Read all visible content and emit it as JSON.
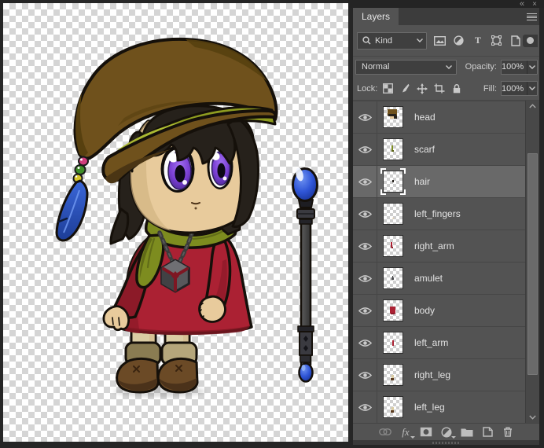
{
  "window": {
    "collapse": "«",
    "close": "×"
  },
  "panel": {
    "tab_label": "Layers",
    "kind_label": "Kind",
    "blend_mode": "Normal",
    "opacity_label": "Opacity:",
    "opacity_value": "100%",
    "lock_label": "Lock:",
    "fill_label": "Fill:",
    "fill_value": "100%",
    "filter_icons": [
      "pixel-layer-filter",
      "adjustment-layer-filter",
      "type-layer-filter",
      "shape-layer-filter",
      "smart-object-filter"
    ],
    "layers": [
      {
        "name": "head",
        "visible": true,
        "selected": false,
        "thumb": "head"
      },
      {
        "name": "scarf",
        "visible": true,
        "selected": false,
        "thumb": "scarf"
      },
      {
        "name": "hair",
        "visible": true,
        "selected": true,
        "thumb": "hair"
      },
      {
        "name": "left_fingers",
        "visible": true,
        "selected": false,
        "thumb": "blank"
      },
      {
        "name": "right_arm",
        "visible": true,
        "selected": false,
        "thumb": "arm"
      },
      {
        "name": "amulet",
        "visible": true,
        "selected": false,
        "thumb": "amulet"
      },
      {
        "name": "body",
        "visible": true,
        "selected": false,
        "thumb": "body"
      },
      {
        "name": "left_arm",
        "visible": true,
        "selected": false,
        "thumb": "arm2"
      },
      {
        "name": "right_leg",
        "visible": true,
        "selected": false,
        "thumb": "leg"
      },
      {
        "name": "left_leg",
        "visible": true,
        "selected": false,
        "thumb": "leg"
      }
    ],
    "thumb_marks": {
      "head": [
        [
          20,
          12,
          50,
          30,
          "#6f511c"
        ],
        [
          32,
          40,
          26,
          18,
          "#e8cb9c"
        ],
        [
          26,
          36,
          40,
          10,
          "#26211b"
        ],
        [
          56,
          42,
          14,
          14,
          "#26211b"
        ]
      ],
      "scarf": [
        [
          40,
          32,
          11,
          22,
          "#7d8c1f"
        ],
        [
          42,
          52,
          12,
          8,
          "#5a6416"
        ]
      ],
      "hair": [
        [
          44,
          42,
          11,
          11,
          "#221d17"
        ]
      ],
      "blank": [
        [
          47,
          68,
          7,
          6,
          "#e8cb9c"
        ]
      ],
      "arm": [
        [
          37,
          30,
          9,
          26,
          "#ab2133"
        ],
        [
          41,
          52,
          10,
          9,
          "#8c1a28"
        ]
      ],
      "amulet": [
        [
          44,
          40,
          7,
          9,
          "#3b3b3b"
        ],
        [
          42,
          48,
          11,
          8,
          "#4f4f52"
        ]
      ],
      "body": [
        [
          33,
          30,
          30,
          36,
          "#ab2133"
        ],
        [
          37,
          60,
          22,
          9,
          "#8c1a28"
        ]
      ],
      "arm2": [
        [
          46,
          40,
          8,
          24,
          "#ab2133"
        ]
      ],
      "leg": [
        [
          42,
          50,
          12,
          16,
          "#dbcda4"
        ],
        [
          37,
          66,
          19,
          12,
          "#5a3a1e"
        ]
      ]
    }
  },
  "icons": {
    "type_filter": "T",
    "fx": "fx"
  },
  "colors": {
    "checker_gray": "#d5d5d5",
    "panel_bg": "#535353",
    "panel_dark": "#3c3c3c",
    "field_bg": "#3f3f3f",
    "field_border": "#6a6a6a",
    "row_selected": "#696969",
    "sb_track": "#484848",
    "sb_thumb": "#6a6a6a",
    "outline": "#15100a",
    "hat_main": "#6f511c",
    "hat_dark": "#57400f",
    "hat_band": "#8e9c20",
    "band_hi": "#b2c135",
    "brim_under": "#4a3514",
    "hair": "#26211b",
    "skin": "#e8cb9c",
    "skin_shadow": "#d2b382",
    "iris": "#7a3fd4",
    "iris_dark": "#46278a",
    "iris_light": "#a06ef0",
    "dress": "#ab2133",
    "dress_dark": "#8c1a28",
    "dress_deep": "#7e1622",
    "scarf": "#7d8c1f",
    "scarf_dark": "#5a6416",
    "legs": "#dbcda4",
    "cuff_left": "#8a7c52",
    "cuff_right": "#b5a67b",
    "boot": "#6b4a26",
    "boot_dark": "#4b321a",
    "chain": "#3b3b3b",
    "pendant": "#58585c",
    "pendant_light": "#6f6f73",
    "pendant_dark": "#414144",
    "bead_pink": "#cf3d7c",
    "bead_green": "#3f8d28",
    "bead_yellow": "#d9c72b",
    "feather_light": "#6e96f0",
    "orb_light": "#6f93f2",
    "orb_mid": "#2f55d6",
    "orb_deep": "#122a86",
    "staff_light": "#5c5c5c",
    "staff_dark": "#333333",
    "staff_metal": "#3a3a40"
  }
}
